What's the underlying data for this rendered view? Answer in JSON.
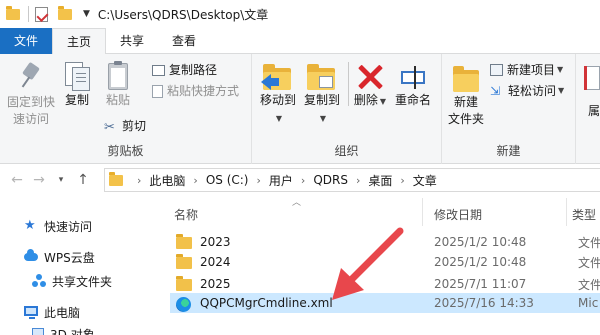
{
  "titlebar": {
    "path": "C:\\Users\\QDRS\\Desktop\\文章"
  },
  "tabs": [
    {
      "label": "文件"
    },
    {
      "label": "主页"
    },
    {
      "label": "共享"
    },
    {
      "label": "查看"
    }
  ],
  "ribbon": {
    "clipboard": {
      "pin_label_1": "固定到快",
      "pin_label_2": "速访问",
      "copy": "复制",
      "paste": "粘贴",
      "copy_path": "复制路径",
      "paste_shortcut": "粘贴快捷方式",
      "cut": "剪切",
      "group": "剪贴板"
    },
    "organize": {
      "move_to": "移动到",
      "copy_to": "复制到",
      "delete": "删除",
      "rename": "重命名",
      "group": "组织"
    },
    "new": {
      "new_folder_1": "新建",
      "new_folder_2": "文件夹",
      "new_item": "新建项目",
      "easy_access": "轻松访问",
      "group": "新建"
    },
    "open": {
      "partial": "属"
    }
  },
  "address": {
    "crumbs": [
      "此电脑",
      "OS (C:)",
      "用户",
      "QDRS",
      "桌面",
      "文章"
    ]
  },
  "navpane": {
    "items": [
      {
        "label": "快速访问",
        "icon": "star-icon"
      },
      {
        "label": "WPS云盘",
        "icon": "cloud-icon"
      },
      {
        "label": "共享文件夹",
        "icon": "share-icon"
      },
      {
        "label": "此电脑",
        "icon": "pc-icon"
      },
      {
        "label": "3D 对象",
        "icon": "3d-objects-icon"
      }
    ]
  },
  "filelist": {
    "columns": {
      "name": "名称",
      "date": "修改日期",
      "type": "类型"
    },
    "rows": [
      {
        "name": "2023",
        "date": "2025/1/2 10:48",
        "type": "文件",
        "kind": "folder"
      },
      {
        "name": "2024",
        "date": "2025/1/2 10:48",
        "type": "文件",
        "kind": "folder"
      },
      {
        "name": "2025",
        "date": "2025/7/1 11:07",
        "type": "文件",
        "kind": "folder"
      },
      {
        "name": "QQPCMgrCmdline.xml",
        "date": "2025/7/16 14:33",
        "type": "Mic",
        "kind": "xml"
      }
    ]
  },
  "colors": {
    "accent": "#1a6fc3",
    "selected_row": "#cce8ff",
    "annotation_arrow": "#e8474c"
  }
}
